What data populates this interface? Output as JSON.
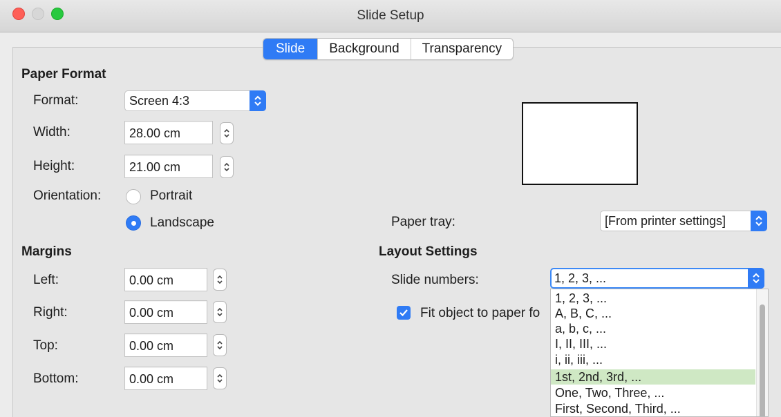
{
  "window": {
    "title": "Slide Setup"
  },
  "tabs": [
    "Slide",
    "Background",
    "Transparency"
  ],
  "paper_format": {
    "heading": "Paper Format",
    "format_label": "Format:",
    "format_value": "Screen 4:3",
    "width_label": "Width:",
    "width_value": "28.00 cm",
    "height_label": "Height:",
    "height_value": "21.00 cm",
    "orientation_label": "Orientation:",
    "portrait_label": "Portrait",
    "landscape_label": "Landscape",
    "orientation_selected": "Landscape"
  },
  "margins": {
    "heading": "Margins",
    "left_label": "Left:",
    "left_value": "0.00 cm",
    "right_label": "Right:",
    "right_value": "0.00 cm",
    "top_label": "Top:",
    "top_value": "0.00 cm",
    "bottom_label": "Bottom:",
    "bottom_value": "0.00 cm"
  },
  "paper_tray": {
    "label": "Paper tray:",
    "value": "[From printer settings]"
  },
  "layout_settings": {
    "heading": "Layout Settings",
    "slide_numbers_label": "Slide numbers:",
    "slide_numbers_value": "1, 2, 3, ...",
    "fit_label": "Fit object to paper fo",
    "fit_checked": true,
    "options": [
      "1, 2, 3, ...",
      "A, B, C, ...",
      "a, b, c, ...",
      "I, II, III, ...",
      "i, ii, iii, ...",
      "1st, 2nd, 3rd, ...",
      "One, Two, Three, ...",
      "First, Second, Third, ..."
    ],
    "highlighted_option": "1st, 2nd, 3rd, ..."
  },
  "colors": {
    "accent": "#2f7bf5",
    "highlight": "#cfe8c4",
    "close": "#fe5f57",
    "maximize": "#27c93f"
  }
}
